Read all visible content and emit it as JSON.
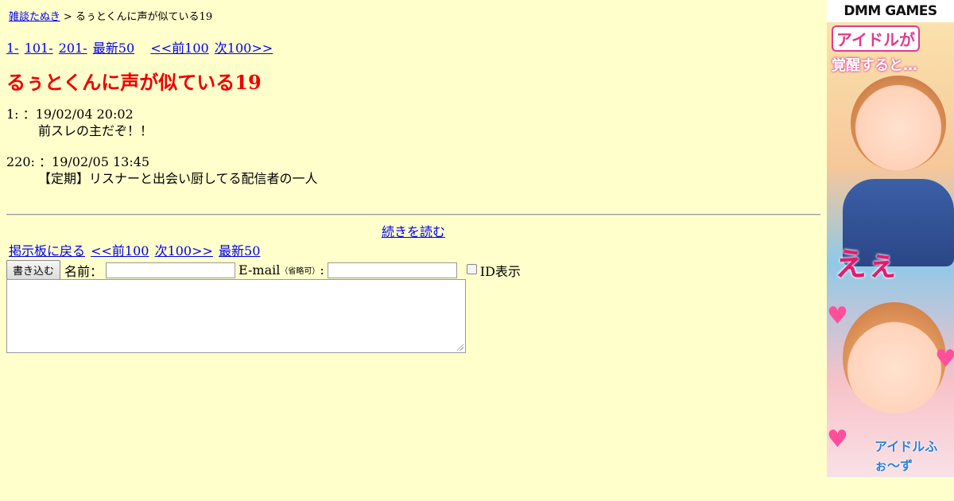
{
  "breadcrumb": {
    "board_link": "雑談たぬき",
    "separator": ">",
    "current": "るぅとくんに声が似ている19"
  },
  "nav_top": {
    "range1": "1-",
    "range2": "101-",
    "range3": "201-",
    "latest": "最新50",
    "prev": "<<前100",
    "next": "次100>>"
  },
  "thread": {
    "title": "るぅとくんに声が似ている19"
  },
  "posts": [
    {
      "header": "1: ：19/02/04 20:02",
      "body": "前スレの主だぞ！！"
    },
    {
      "header": "220: ：19/02/05 13:45",
      "body": "【定期】リスナーと出会い厨してる配信者の一人"
    }
  ],
  "read_more": "続きを読む",
  "nav_bottom": {
    "back": "掲示板に戻る",
    "prev": "<<前100",
    "next": "次100>>",
    "latest": "最新50"
  },
  "form": {
    "submit": "書き込む",
    "name_label": "名前：",
    "email_label": "E-mail",
    "email_note": "（省略可）",
    "email_colon": ":",
    "name_value": "",
    "email_value": "",
    "id_label": "ID表示",
    "message_value": ""
  },
  "ad": {
    "header": "DMM GAMES",
    "line1": "アイドルが",
    "line2": "覚醒すると…",
    "exclaim": "えぇ",
    "logo": "アイドルふぉ〜ず",
    "icon": "banner-ad",
    "heart_icon": "heart-icon"
  }
}
